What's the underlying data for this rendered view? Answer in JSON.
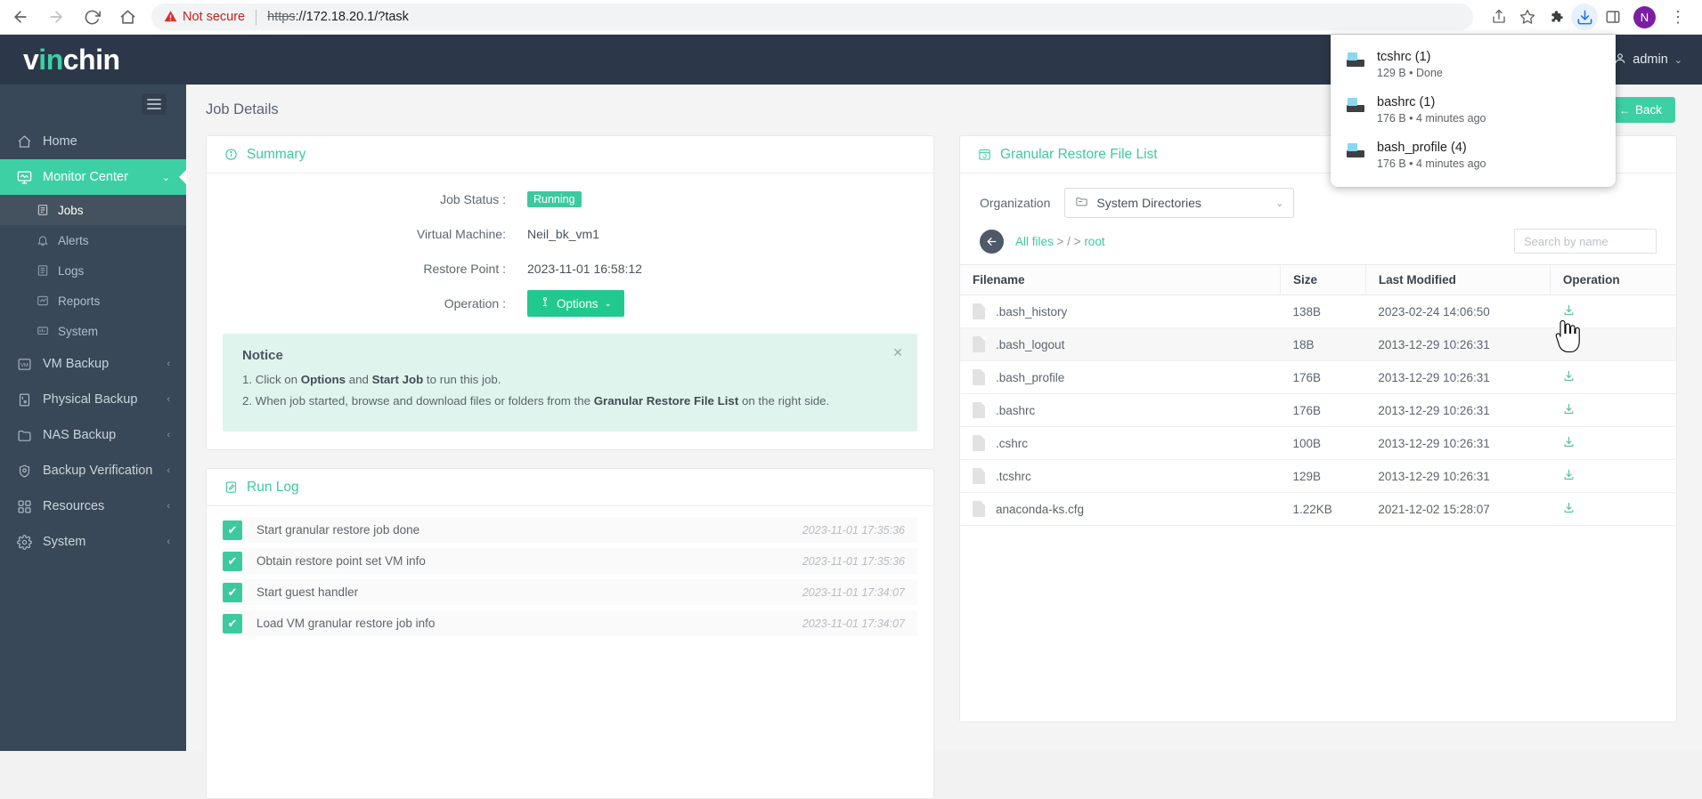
{
  "browser": {
    "back_icon": "back-arrow-icon",
    "forward_icon": "forward-arrow-icon",
    "reload_icon": "reload-icon",
    "home_icon": "home-icon",
    "warning_icon": "warning-triangle-icon",
    "security_label": "Not secure",
    "url_scheme": "https",
    "url_rest": "://172.18.20.1/?task",
    "share_icon": "share-icon",
    "bookmark_icon": "star-icon",
    "extensions_icon": "puzzle-piece-icon",
    "downloads_icon": "download-tray-icon",
    "sidepanel_icon": "side-panel-icon",
    "profile_initial": "N",
    "menu_icon": "kebab-menu-icon"
  },
  "downloads": {
    "items": [
      {
        "name": "tcshrc (1)",
        "detail": "129 B • Done"
      },
      {
        "name": "bashrc (1)",
        "detail": "176 B • 4 minutes ago"
      },
      {
        "name": "bash_profile (4)",
        "detail": "176 B • 4 minutes ago"
      }
    ]
  },
  "header": {
    "brand_v": "v",
    "brand_in": "in",
    "brand_chin": "chin",
    "user_icon": "user-icon",
    "user_name": "admin",
    "caret": "⌄"
  },
  "sidebar": {
    "hamburger": "hamburger-icon",
    "items": [
      {
        "label": "Home",
        "icon": "home-icon",
        "active": false,
        "caret": ""
      },
      {
        "label": "Monitor Center",
        "icon": "monitor-icon",
        "active": true,
        "caret": "⌄"
      },
      {
        "label": "VM Backup",
        "icon": "vm-icon",
        "active": false,
        "caret": "‹"
      },
      {
        "label": "Physical Backup",
        "icon": "server-icon",
        "active": false,
        "caret": "‹"
      },
      {
        "label": "NAS Backup",
        "icon": "nas-folder-icon",
        "active": false,
        "caret": "‹"
      },
      {
        "label": "Backup Verification",
        "icon": "shield-check-icon",
        "active": false,
        "caret": "‹"
      },
      {
        "label": "Resources",
        "icon": "grid-icon",
        "active": false,
        "caret": "‹"
      },
      {
        "label": "System",
        "icon": "gear-icon",
        "active": false,
        "caret": "‹"
      }
    ],
    "sub_items": [
      {
        "label": "Jobs",
        "icon": "list-icon",
        "active": true
      },
      {
        "label": "Alerts",
        "icon": "bell-icon",
        "active": false
      },
      {
        "label": "Logs",
        "icon": "document-icon",
        "active": false
      },
      {
        "label": "Reports",
        "icon": "chart-icon",
        "active": false
      },
      {
        "label": "System",
        "icon": "system-chart-icon",
        "active": false
      }
    ]
  },
  "page": {
    "title": "Job Details",
    "back_label": "Back",
    "back_arrow": "←"
  },
  "summary": {
    "card_title": "Summary",
    "card_icon": "info-circle-icon",
    "rows": [
      {
        "label": "Job Status :",
        "value": "Running",
        "type": "badge"
      },
      {
        "label": "Virtual Machine:",
        "value": "Neil_bk_vm1",
        "type": "text"
      },
      {
        "label": "Restore Point :",
        "value": "2023-11-01 16:58:12",
        "type": "text"
      },
      {
        "label": "Operation :",
        "value": "Options",
        "type": "button"
      }
    ],
    "options_icon": "usb-plug-icon",
    "options_caret": "⌄"
  },
  "notice": {
    "title": "Notice",
    "close_icon": "close-icon",
    "line1_pre": "1. Click on ",
    "line1_b1": "Options",
    "line1_mid": " and ",
    "line1_b2": "Start Job",
    "line1_post": " to run this job.",
    "line2_pre": "2. When job started, browse and download files or folders from the ",
    "line2_b1": "Granular Restore File List",
    "line2_post": " on the right side."
  },
  "runlog": {
    "card_title": "Run Log",
    "card_icon": "edit-document-icon",
    "check_glyph": "✔",
    "entries": [
      {
        "text": "Start granular restore job done",
        "time": "2023-11-01 17:35:36"
      },
      {
        "text": "Obtain restore point set VM info",
        "time": "2023-11-01 17:35:36"
      },
      {
        "text": "Start guest handler",
        "time": "2023-11-01 17:34:07"
      },
      {
        "text": "Load VM granular restore job info",
        "time": "2023-11-01 17:34:07"
      }
    ]
  },
  "filelist": {
    "card_title": "Granular Restore File List",
    "card_icon": "calendar-restore-icon",
    "org_label": "Organization",
    "org_value": "System Directories",
    "org_icon": "folder-icon",
    "org_caret": "⌄",
    "back_circle_icon": "arrow-left-circle-icon",
    "crumb_root": "All files",
    "crumb_sep1": " > ",
    "crumb_slash": "/",
    "crumb_sep2": " > ",
    "crumb_current": "root",
    "search_placeholder": "Search by name",
    "search_value": "",
    "columns": [
      "Filename",
      "Size",
      "Last Modified",
      "Operation"
    ],
    "rows": [
      {
        "filename": ".bash_history",
        "size": "138B",
        "modified": "2023-02-24 14:06:50",
        "op_icon": "download-icon",
        "hover": false
      },
      {
        "filename": ".bash_logout",
        "size": "18B",
        "modified": "2013-12-29 10:26:31",
        "op_icon": "download-icon",
        "hover": true
      },
      {
        "filename": ".bash_profile",
        "size": "176B",
        "modified": "2013-12-29 10:26:31",
        "op_icon": "download-icon",
        "hover": false
      },
      {
        "filename": ".bashrc",
        "size": "176B",
        "modified": "2013-12-29 10:26:31",
        "op_icon": "download-icon",
        "hover": false
      },
      {
        "filename": ".cshrc",
        "size": "100B",
        "modified": "2013-12-29 10:26:31",
        "op_icon": "download-icon",
        "hover": false
      },
      {
        "filename": ".tcshrc",
        "size": "129B",
        "modified": "2013-12-29 10:26:31",
        "op_icon": "download-icon",
        "hover": false
      },
      {
        "filename": "anaconda-ks.cfg",
        "size": "1.22KB",
        "modified": "2021-12-02 15:28:07",
        "op_icon": "download-icon",
        "hover": false
      }
    ]
  },
  "colors": {
    "accent_green": "#3dd0a5",
    "sidebar_bg": "#394858",
    "header_bg": "#2c3849",
    "notice_bg": "#dff4ec",
    "status_running": "#3dc9a0"
  }
}
